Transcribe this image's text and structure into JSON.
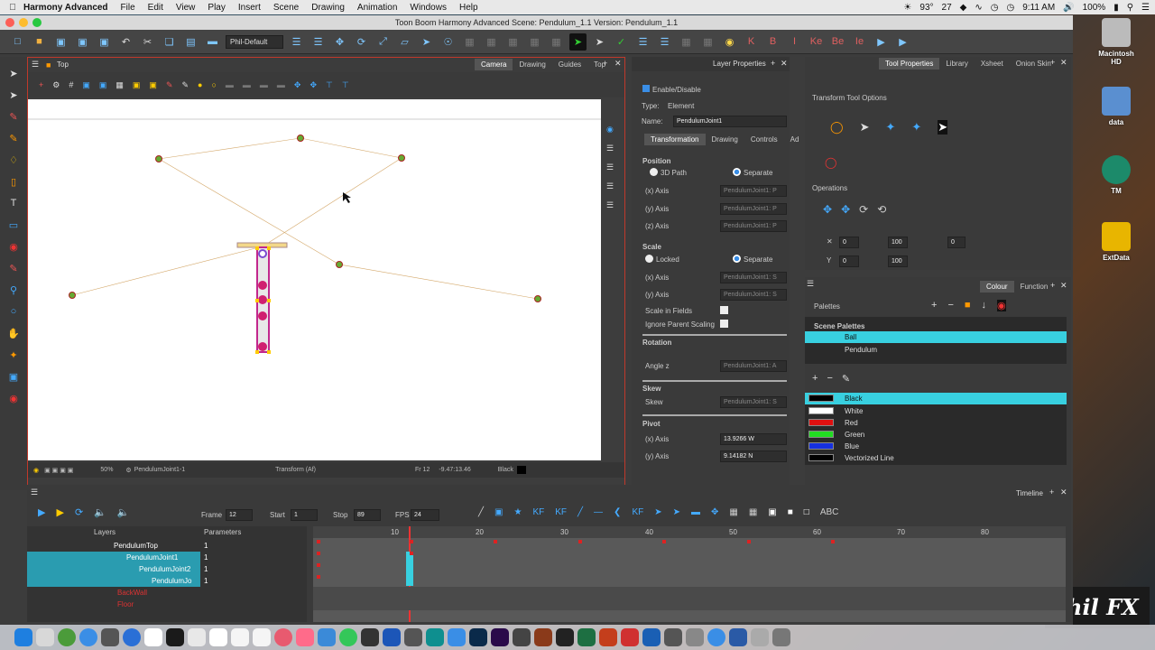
{
  "menubar": {
    "app_name": "Harmony Advanced",
    "items": [
      "File",
      "Edit",
      "View",
      "Play",
      "Insert",
      "Scene",
      "Drawing",
      "Animation",
      "Windows",
      "Help"
    ],
    "status": {
      "temp": "93°",
      "date": "27",
      "time": "9:11 AM",
      "battery": "100%"
    }
  },
  "window": {
    "title": "Toon Boom Harmony Advanced Scene: Pendulum_1.1 Version: Pendulum_1.1"
  },
  "toolbar": {
    "workspace": "Phil-Default"
  },
  "camera_view": {
    "title": "Top",
    "tabs": [
      "Camera",
      "Drawing",
      "Guides",
      "Top"
    ],
    "status": {
      "zoom": "50%",
      "layer": "PendulumJoint1-1",
      "tool": "Transform (Af)",
      "frame": "Fr 12",
      "coords": "-9.47:13.46",
      "colour": "Black"
    }
  },
  "layer_props": {
    "title": "Layer Properties",
    "enable": "Enable/Disable",
    "type_label": "Type:",
    "type_value": "Element",
    "name_label": "Name:",
    "name_value": "PendulumJoint1",
    "tabs": [
      "Transformation",
      "Drawing",
      "Controls",
      "Ad"
    ],
    "position": "Position",
    "path3d": "3D Path",
    "separate": "Separate",
    "x_axis": "(x) Axis",
    "y_axis": "(y) Axis",
    "z_axis": "(z) Axis",
    "field_x": "PendulumJoint1: P",
    "field_y": "PendulumJoint1: P",
    "field_z": "PendulumJoint1: P",
    "scale": "Scale",
    "locked": "Locked",
    "scale_x": "PendulumJoint1: S",
    "scale_y": "PendulumJoint1: S",
    "scale_fields": "Scale in Fields",
    "ignore_parent": "Ignore Parent Scaling",
    "rotation": "Rotation",
    "angle_z": "Angle z",
    "angle_field": "PendulumJoint1: A",
    "skew_section": "Skew",
    "skew": "Skew",
    "skew_field": "PendulumJoint1: S",
    "pivot": "Pivot",
    "pivot_x": "13.9266 W",
    "pivot_y": "9.14182 N"
  },
  "tool_props": {
    "tabs": [
      "Tool Properties",
      "Library",
      "Xsheet",
      "Onion Skin"
    ],
    "options_title": "Transform Tool Options",
    "operations": "Operations",
    "x_val": "0",
    "w_val": "100",
    "y_val": "0",
    "h_val": "100",
    "angle_val": "0"
  },
  "colour": {
    "tabs": [
      "Colour",
      "Function"
    ],
    "palettes_label": "Palettes",
    "scene_palettes": "Scene Palettes",
    "palettes": [
      "Ball",
      "Pendulum"
    ],
    "swatches": [
      {
        "name": "Black",
        "color": "#000000"
      },
      {
        "name": "White",
        "color": "#ffffff"
      },
      {
        "name": "Red",
        "color": "#e01010"
      },
      {
        "name": "Green",
        "color": "#22dd22"
      },
      {
        "name": "Blue",
        "color": "#1530e0"
      },
      {
        "name": "Vectorized Line",
        "color": "#000000"
      }
    ]
  },
  "timeline": {
    "title": "Timeline",
    "frame_label": "Frame",
    "frame": "12",
    "start_label": "Start",
    "start": "1",
    "stop_label": "Stop",
    "stop": "89",
    "fps_label": "FPS",
    "fps": "24",
    "layers_header": "Layers",
    "params_header": "Parameters",
    "layers": [
      {
        "name": "PendulumTop",
        "val": "1"
      },
      {
        "name": "PendulumJoint1",
        "val": "1"
      },
      {
        "name": "PendulumJoint2",
        "val": "1"
      },
      {
        "name": "PendulumJo",
        "val": "1"
      },
      {
        "name": "BackWall",
        "val": ""
      },
      {
        "name": "Floor",
        "val": ""
      }
    ],
    "ruler": [
      "10",
      "20",
      "30",
      "40",
      "50",
      "60",
      "70",
      "80"
    ]
  },
  "desktop": {
    "icons": [
      "Macintosh HD",
      "data",
      "TM",
      "ExtData"
    ],
    "watermark": "Phil FX"
  }
}
